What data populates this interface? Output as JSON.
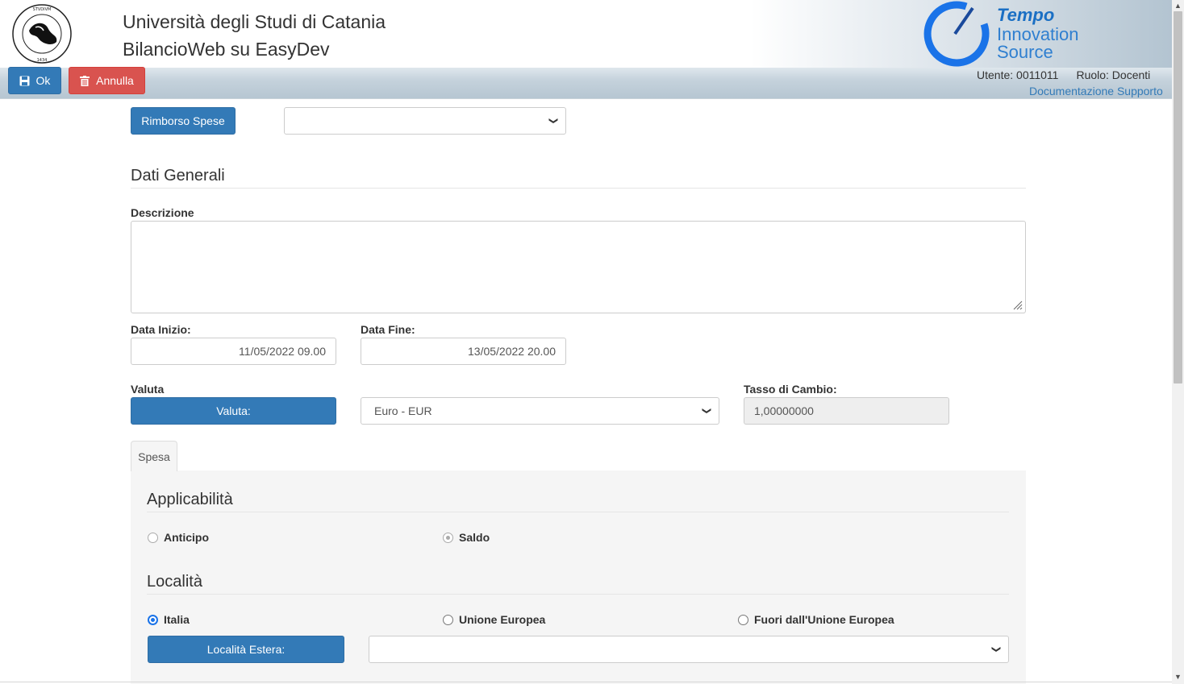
{
  "header": {
    "title_line1": "Università degli Studi di Catania",
    "title_line2": "BilancioWeb su EasyDev",
    "seal_text": "SICILIAE STVDIVM GENERALE 1434",
    "brand": {
      "word1": "Tempo",
      "word2": "Innovation",
      "word3": "Source"
    },
    "user": "Utente: 0011011",
    "role": "Ruolo: Docenti",
    "doc_link": "Documentazione Supporto"
  },
  "toolbar": {
    "ok_label": "Ok",
    "annulla_label": "Annulla"
  },
  "form": {
    "rimborso_button": "Rimborso Spese",
    "rimborso_select_value": "",
    "section_dati_generali": "Dati Generali",
    "descrizione_label": "Descrizione",
    "descrizione_value": "",
    "data_inizio_label": "Data Inizio:",
    "data_inizio_value": "11/05/2022 09.00",
    "data_fine_label": "Data Fine:",
    "data_fine_value": "13/05/2022 20.00",
    "valuta_label": "Valuta",
    "valuta_button": "Valuta:",
    "valuta_select_value": "Euro - EUR",
    "tasso_label": "Tasso di Cambio:",
    "tasso_value": "1,00000000"
  },
  "tabs": [
    {
      "label": "Spesa"
    }
  ],
  "spesa": {
    "applicabilita_title": "Applicabilità",
    "applicabilita_options": [
      {
        "label": "Anticipo",
        "checked": false
      },
      {
        "label": "Saldo",
        "checked": true
      }
    ],
    "localita_title": "Località",
    "localita_options": [
      {
        "label": "Italia",
        "checked": true
      },
      {
        "label": "Unione Europea",
        "checked": false
      },
      {
        "label": "Fuori dall'Unione Europea",
        "checked": false
      }
    ],
    "localita_estera_button": "Località Estera:",
    "localita_estera_value": ""
  },
  "colors": {
    "primary": "#337ab7",
    "danger": "#d9534f",
    "link": "#337ab7",
    "radio_checked": "#1a73e8"
  }
}
